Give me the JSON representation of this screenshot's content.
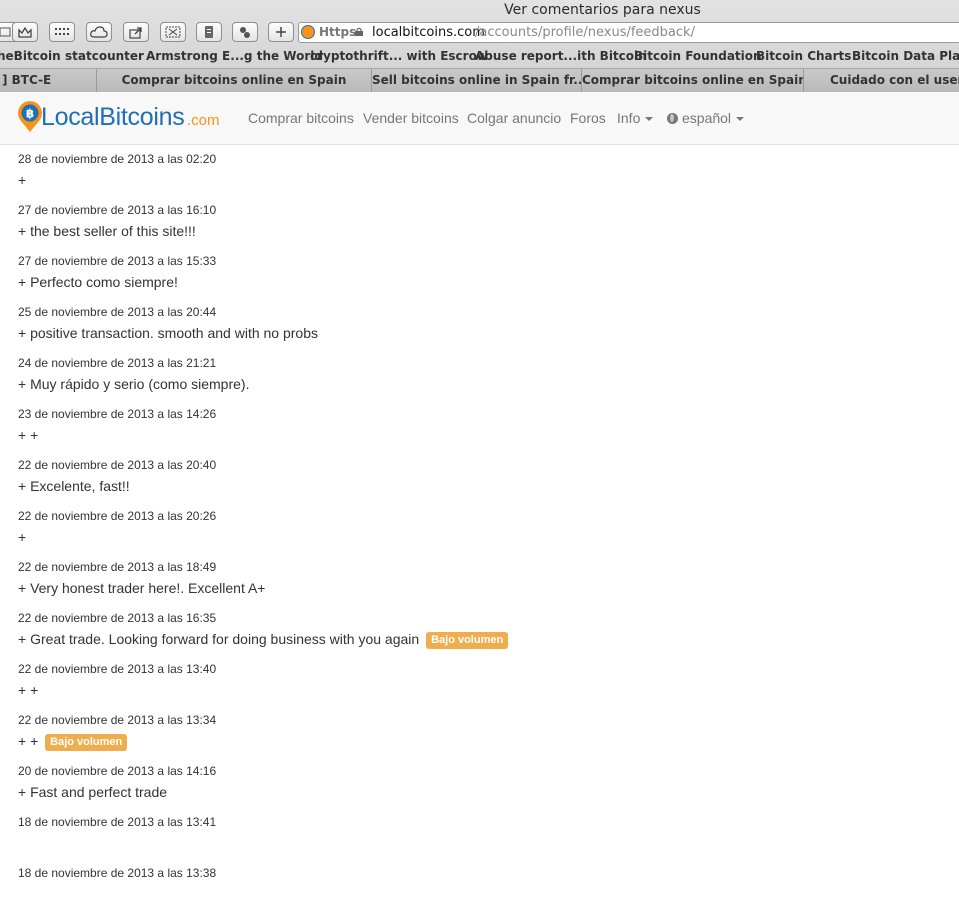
{
  "window": {
    "title": "Ver comentarios para nexus"
  },
  "address_bar": {
    "scheme": "https",
    "domain": "localbitcoins.com",
    "path": "/accounts/profile/nexus/feedback/"
  },
  "toolbar_icons": [
    "book-icon",
    "crown-icon",
    "grid-icon",
    "cloud-icon",
    "share-icon",
    "screenshot-icon",
    "file-icon",
    "evernote-icon",
    "add-icon"
  ],
  "bookmarks": [
    "heBitcoin",
    "statcounter",
    "Armstrong E...g the World",
    "cryptothrift... with Escrow",
    "Abuse report...ith Bitcoin",
    "Bitcoin Foundation",
    "Bitcoin Charts",
    "Bitcoin Data Platfo"
  ],
  "tabs": [
    "] BTC-E",
    "Comprar bitcoins online en Spain",
    "Sell bitcoins online in Spain fr...",
    "Comprar bitcoins online en Spain",
    "Cuidado con el user \"n"
  ],
  "site": {
    "logo_main": "LocalBitcoins",
    "logo_domain": ".com",
    "nav": {
      "buy": "Comprar bitcoins",
      "sell": "Vender bitcoins",
      "post": "Colgar anuncio",
      "forums": "Foros",
      "info": "Info",
      "language": "español"
    }
  },
  "feedback": [
    {
      "date": "28 de noviembre de 2013 a las 02:20",
      "text": "+",
      "badge": ""
    },
    {
      "date": "27 de noviembre de 2013 a las 16:10",
      "text": "+ the best seller of this site!!!",
      "badge": ""
    },
    {
      "date": "27 de noviembre de 2013 a las 15:33",
      "text": "+ Perfecto como siempre!",
      "badge": ""
    },
    {
      "date": "25 de noviembre de 2013 a las 20:44",
      "text": "+ positive transaction. smooth and with no probs",
      "badge": ""
    },
    {
      "date": "24 de noviembre de 2013 a las 21:21",
      "text": "+ Muy rápido y serio (como siempre).",
      "badge": ""
    },
    {
      "date": "23 de noviembre de 2013 a las 14:26",
      "text": "+ +",
      "badge": ""
    },
    {
      "date": "22 de noviembre de 2013 a las 20:40",
      "text": "+ Excelente, fast!!",
      "badge": ""
    },
    {
      "date": "22 de noviembre de 2013 a las 20:26",
      "text": "+",
      "badge": ""
    },
    {
      "date": "22 de noviembre de 2013 a las 18:49",
      "text": "+ Very honest trader here!. Excellent A+",
      "badge": ""
    },
    {
      "date": "22 de noviembre de 2013 a las 16:35",
      "text": "+ Great trade. Looking forward for doing business with you again",
      "badge": "Bajo volumen"
    },
    {
      "date": "22 de noviembre de 2013 a las 13:40",
      "text": "+ +",
      "badge": ""
    },
    {
      "date": "22 de noviembre de 2013 a las 13:34",
      "text": "+ +",
      "badge": "Bajo volumen"
    },
    {
      "date": "20 de noviembre de 2013 a las 14:16",
      "text": "+ Fast and perfect trade",
      "badge": ""
    },
    {
      "date": "18 de noviembre de 2013 a las 13:41",
      "text": "",
      "badge": ""
    },
    {
      "date": "18 de noviembre de 2013 a las 13:38",
      "text": "",
      "badge": ""
    }
  ]
}
